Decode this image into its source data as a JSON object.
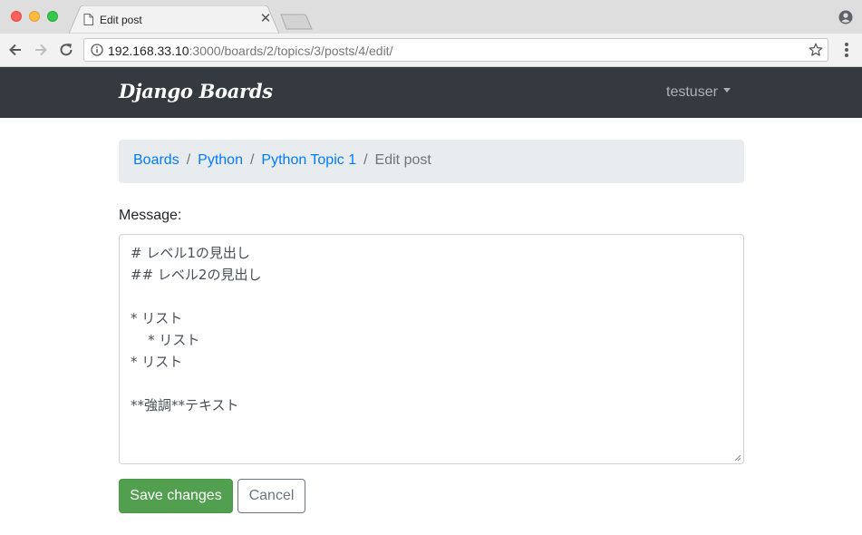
{
  "browser": {
    "tab_title": "Edit post",
    "url_host": "192.168.33.10",
    "url_rest": ":3000/boards/2/topics/3/posts/4/edit/"
  },
  "navbar": {
    "brand": "Django Boards",
    "username": "testuser"
  },
  "breadcrumb": {
    "items": [
      "Boards",
      "Python",
      "Python Topic 1"
    ],
    "active": "Edit post",
    "separator": "/"
  },
  "form": {
    "message_label": "Message:",
    "message_lines": [
      "# レベル1の見出し",
      "## レベル2の見出し",
      "",
      "* リスト",
      "    * リスト",
      "* リスト",
      "",
      "**強調**テキスト"
    ],
    "save_label": "Save changes",
    "cancel_label": "Cancel"
  },
  "colors": {
    "navbar_bg": "#343a40",
    "link": "#007bff",
    "success": "#52a04f",
    "breadcrumb_bg": "#e9ecef"
  }
}
